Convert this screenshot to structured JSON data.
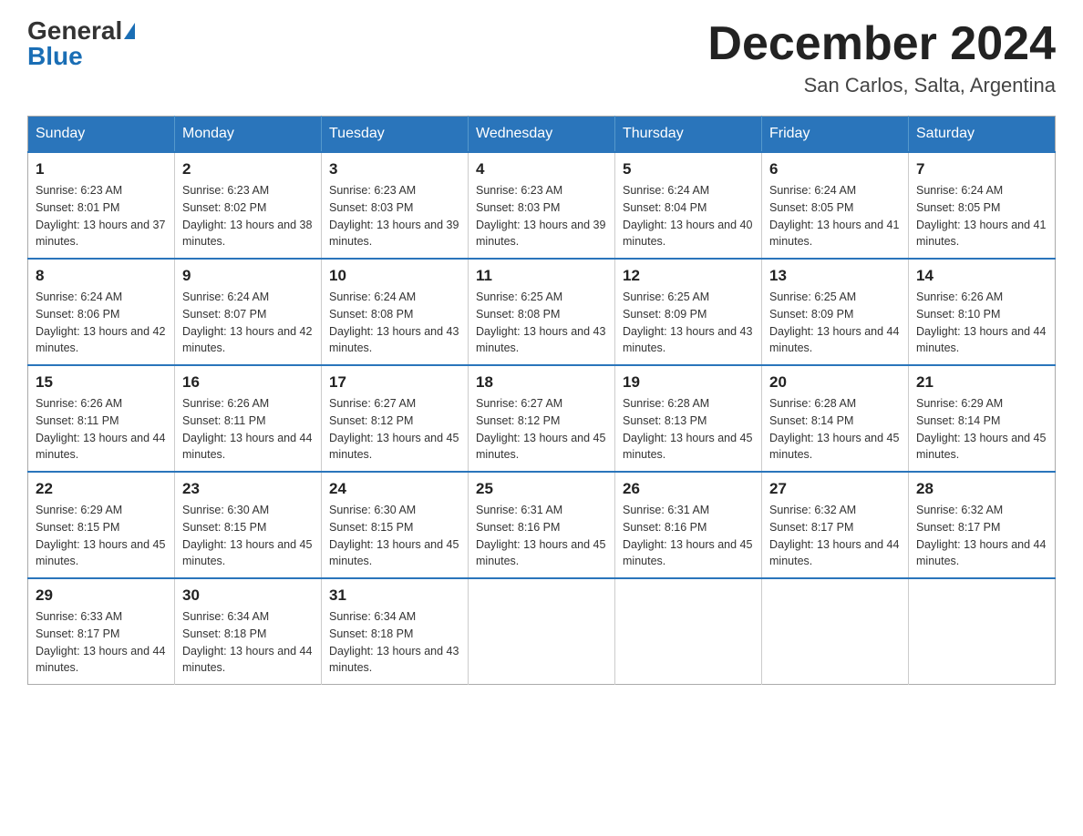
{
  "logo": {
    "general": "General",
    "blue": "Blue",
    "triangle": "▲"
  },
  "title": {
    "month_year": "December 2024",
    "location": "San Carlos, Salta, Argentina"
  },
  "headers": [
    "Sunday",
    "Monday",
    "Tuesday",
    "Wednesday",
    "Thursday",
    "Friday",
    "Saturday"
  ],
  "weeks": [
    [
      {
        "day": "1",
        "sunrise": "6:23 AM",
        "sunset": "8:01 PM",
        "daylight": "13 hours and 37 minutes."
      },
      {
        "day": "2",
        "sunrise": "6:23 AM",
        "sunset": "8:02 PM",
        "daylight": "13 hours and 38 minutes."
      },
      {
        "day": "3",
        "sunrise": "6:23 AM",
        "sunset": "8:03 PM",
        "daylight": "13 hours and 39 minutes."
      },
      {
        "day": "4",
        "sunrise": "6:23 AM",
        "sunset": "8:03 PM",
        "daylight": "13 hours and 39 minutes."
      },
      {
        "day": "5",
        "sunrise": "6:24 AM",
        "sunset": "8:04 PM",
        "daylight": "13 hours and 40 minutes."
      },
      {
        "day": "6",
        "sunrise": "6:24 AM",
        "sunset": "8:05 PM",
        "daylight": "13 hours and 41 minutes."
      },
      {
        "day": "7",
        "sunrise": "6:24 AM",
        "sunset": "8:05 PM",
        "daylight": "13 hours and 41 minutes."
      }
    ],
    [
      {
        "day": "8",
        "sunrise": "6:24 AM",
        "sunset": "8:06 PM",
        "daylight": "13 hours and 42 minutes."
      },
      {
        "day": "9",
        "sunrise": "6:24 AM",
        "sunset": "8:07 PM",
        "daylight": "13 hours and 42 minutes."
      },
      {
        "day": "10",
        "sunrise": "6:24 AM",
        "sunset": "8:08 PM",
        "daylight": "13 hours and 43 minutes."
      },
      {
        "day": "11",
        "sunrise": "6:25 AM",
        "sunset": "8:08 PM",
        "daylight": "13 hours and 43 minutes."
      },
      {
        "day": "12",
        "sunrise": "6:25 AM",
        "sunset": "8:09 PM",
        "daylight": "13 hours and 43 minutes."
      },
      {
        "day": "13",
        "sunrise": "6:25 AM",
        "sunset": "8:09 PM",
        "daylight": "13 hours and 44 minutes."
      },
      {
        "day": "14",
        "sunrise": "6:26 AM",
        "sunset": "8:10 PM",
        "daylight": "13 hours and 44 minutes."
      }
    ],
    [
      {
        "day": "15",
        "sunrise": "6:26 AM",
        "sunset": "8:11 PM",
        "daylight": "13 hours and 44 minutes."
      },
      {
        "day": "16",
        "sunrise": "6:26 AM",
        "sunset": "8:11 PM",
        "daylight": "13 hours and 44 minutes."
      },
      {
        "day": "17",
        "sunrise": "6:27 AM",
        "sunset": "8:12 PM",
        "daylight": "13 hours and 45 minutes."
      },
      {
        "day": "18",
        "sunrise": "6:27 AM",
        "sunset": "8:12 PM",
        "daylight": "13 hours and 45 minutes."
      },
      {
        "day": "19",
        "sunrise": "6:28 AM",
        "sunset": "8:13 PM",
        "daylight": "13 hours and 45 minutes."
      },
      {
        "day": "20",
        "sunrise": "6:28 AM",
        "sunset": "8:14 PM",
        "daylight": "13 hours and 45 minutes."
      },
      {
        "day": "21",
        "sunrise": "6:29 AM",
        "sunset": "8:14 PM",
        "daylight": "13 hours and 45 minutes."
      }
    ],
    [
      {
        "day": "22",
        "sunrise": "6:29 AM",
        "sunset": "8:15 PM",
        "daylight": "13 hours and 45 minutes."
      },
      {
        "day": "23",
        "sunrise": "6:30 AM",
        "sunset": "8:15 PM",
        "daylight": "13 hours and 45 minutes."
      },
      {
        "day": "24",
        "sunrise": "6:30 AM",
        "sunset": "8:15 PM",
        "daylight": "13 hours and 45 minutes."
      },
      {
        "day": "25",
        "sunrise": "6:31 AM",
        "sunset": "8:16 PM",
        "daylight": "13 hours and 45 minutes."
      },
      {
        "day": "26",
        "sunrise": "6:31 AM",
        "sunset": "8:16 PM",
        "daylight": "13 hours and 45 minutes."
      },
      {
        "day": "27",
        "sunrise": "6:32 AM",
        "sunset": "8:17 PM",
        "daylight": "13 hours and 44 minutes."
      },
      {
        "day": "28",
        "sunrise": "6:32 AM",
        "sunset": "8:17 PM",
        "daylight": "13 hours and 44 minutes."
      }
    ],
    [
      {
        "day": "29",
        "sunrise": "6:33 AM",
        "sunset": "8:17 PM",
        "daylight": "13 hours and 44 minutes."
      },
      {
        "day": "30",
        "sunrise": "6:34 AM",
        "sunset": "8:18 PM",
        "daylight": "13 hours and 44 minutes."
      },
      {
        "day": "31",
        "sunrise": "6:34 AM",
        "sunset": "8:18 PM",
        "daylight": "13 hours and 43 minutes."
      },
      null,
      null,
      null,
      null
    ]
  ]
}
